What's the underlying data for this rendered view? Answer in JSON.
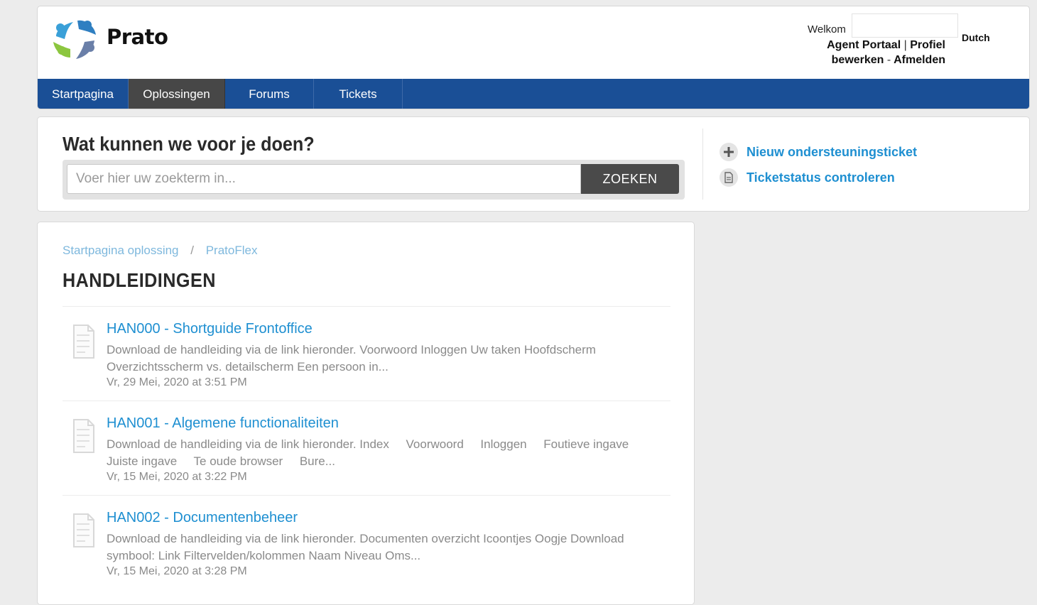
{
  "header": {
    "brand": "Prato",
    "welcome": "Welkom",
    "language": "Dutch",
    "agent_portal": "Agent Portaal",
    "sep1": "|",
    "edit_profile": "Profiel bewerken",
    "sep2": "-",
    "logout": "Afmelden"
  },
  "nav": {
    "items": [
      {
        "label": "Startpagina"
      },
      {
        "label": "Oplossingen"
      },
      {
        "label": "Forums"
      },
      {
        "label": "Tickets"
      }
    ]
  },
  "search": {
    "title": "Wat kunnen we voor je doen?",
    "placeholder": "Voer hier uw zoekterm in...",
    "button": "ZOEKEN"
  },
  "actions": {
    "new_ticket": "Nieuw ondersteuningsticket",
    "check_status": "Ticketstatus controleren"
  },
  "breadcrumb": {
    "home": "Startpagina oplossing",
    "sep": "/",
    "current": "PratoFlex"
  },
  "page_title": "HANDLEIDINGEN",
  "articles": [
    {
      "title": "HAN000 - Shortguide Frontoffice",
      "desc": "Download de handleiding via de link hieronder. Voorwoord Inloggen Uw taken Hoofdscherm Overzichtsscherm vs. detailscherm Een persoon in...",
      "date": "Vr, 29 Mei, 2020 at 3:51 PM"
    },
    {
      "title": "HAN001 - Algemene functionaliteiten",
      "desc": "Download de handleiding via de link hieronder. Index     Voorwoord     Inloggen     Foutieve ingave     Juiste ingave     Te oude browser     Bure...",
      "date": "Vr, 15 Mei, 2020 at 3:22 PM"
    },
    {
      "title": "HAN002 - Documentenbeheer",
      "desc": "Download de handleiding via de link hieronder. Documenten overzicht Icoontjes Oogje Download symbool: Link Filtervelden/kolommen Naam Niveau Oms...",
      "date": "Vr, 15 Mei, 2020 at 3:28 PM"
    }
  ],
  "colors": {
    "nav_bg": "#1a4f96",
    "nav_active": "#474747",
    "link": "#1e8fd1",
    "breadcrumb": "#7eb8dd"
  }
}
